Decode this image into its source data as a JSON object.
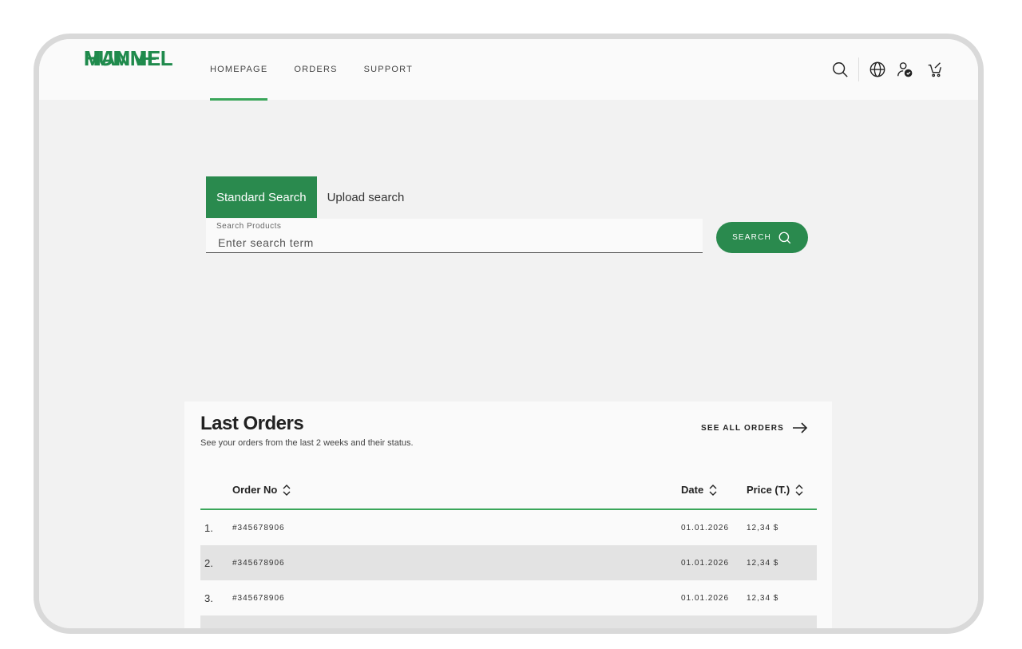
{
  "brand": {
    "line1": "MANN+",
    "line2": "HUMMEL",
    "color": "#1f8a4c"
  },
  "nav": {
    "items": [
      "HOMEPAGE",
      "ORDERS",
      "SUPPORT"
    ],
    "active": "HOMEPAGE"
  },
  "header_icons": [
    "search-icon",
    "globe-icon",
    "user-check-icon",
    "cart-icon"
  ],
  "search": {
    "tabs": [
      "Standard Search",
      "Upload search"
    ],
    "active_tab": "Standard Search",
    "field_label": "Search Products",
    "placeholder": "Enter search term",
    "value": "",
    "button_label": "SEARCH"
  },
  "orders": {
    "title": "Last Orders",
    "subtitle": "See your orders from the last 2 weeks and their status.",
    "see_all_label": "SEE ALL ORDERS",
    "columns": {
      "order_no": "Order No",
      "date": "Date",
      "price": "Price (T.)"
    },
    "rows": [
      {
        "index": "1.",
        "order_no": "#345678906",
        "date": "01.01.2026",
        "price": "12,34 $"
      },
      {
        "index": "2.",
        "order_no": "#345678906",
        "date": "01.01.2026",
        "price": "12,34 $"
      },
      {
        "index": "3.",
        "order_no": "#345678906",
        "date": "01.01.2026",
        "price": "12,34 $"
      }
    ]
  },
  "colors": {
    "accent": "#2a8a4e",
    "accent_line": "#3aa65a",
    "background": "#f2f2f2"
  }
}
